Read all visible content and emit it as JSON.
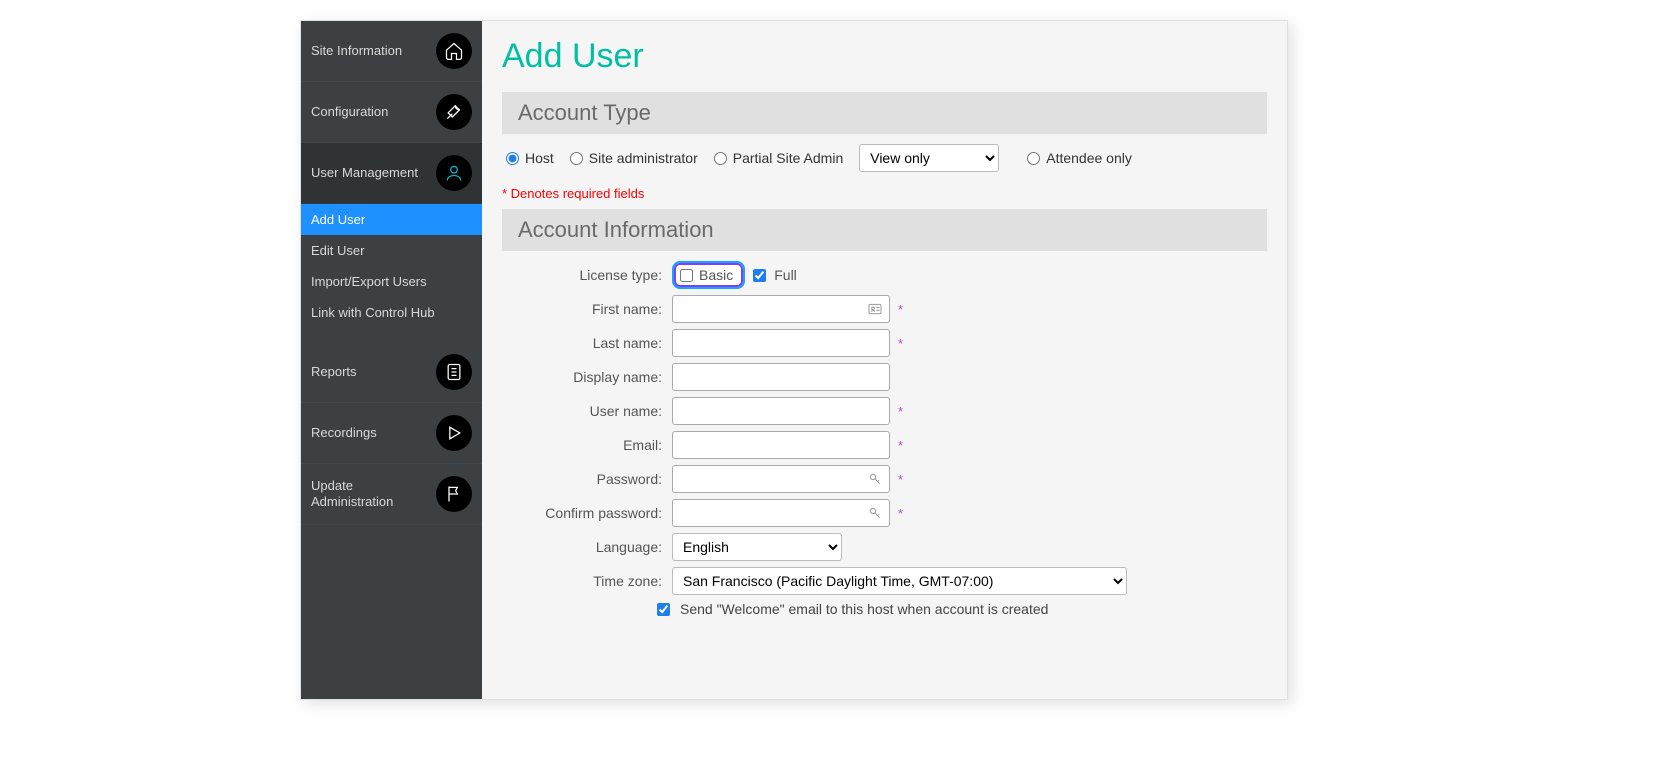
{
  "sidebar": {
    "site_information": "Site Information",
    "configuration": "Configuration",
    "user_management": "User Management",
    "subitems": {
      "add_user": "Add User",
      "edit_user": "Edit User",
      "import_export": "Import/Export Users",
      "link_control_hub": "Link with Control Hub"
    },
    "reports": "Reports",
    "recordings": "Recordings",
    "update_admin": "Update Administration"
  },
  "page": {
    "title": "Add User",
    "account_type_header": "Account Type",
    "radios": {
      "host": "Host",
      "site_admin": "Site administrator",
      "partial_site_admin": "Partial Site Admin",
      "attendee_only": "Attendee only"
    },
    "partial_dropdown": "View only",
    "required_note": "* Denotes required fields",
    "account_info_header": "Account Information",
    "labels": {
      "license_type": "License type:",
      "first_name": "First name:",
      "last_name": "Last name:",
      "display_name": "Display name:",
      "user_name": "User name:",
      "email": "Email:",
      "password": "Password:",
      "confirm_password": "Confirm password:",
      "language": "Language:",
      "time_zone": "Time zone:"
    },
    "license_basic": "Basic",
    "license_full": "Full",
    "language_value": "English",
    "tz_value": "San Francisco (Pacific Daylight Time, GMT-07:00)",
    "send_welcome": "Send \"Welcome\" email to this host when account is created"
  }
}
